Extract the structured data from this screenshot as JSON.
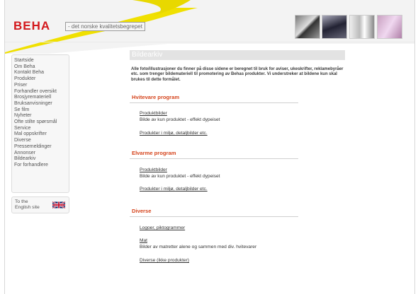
{
  "brand": {
    "logo": "BEHA",
    "tagline": "- det norske kvalitetsbegrepet"
  },
  "colors": {
    "brand_red": "#d3181c",
    "section_orange": "#d5441c",
    "swoosh_yellow": "#f0e000"
  },
  "sidebar": {
    "items": [
      "Startside",
      "Om Beha",
      "Kontakt Beha",
      "Produkter",
      "Priser",
      "Forhandler oversikt",
      "Brosjyremateriell",
      "Bruksanvisninger",
      "Se film",
      "Nyheter",
      "Ofte stilte spørsmål",
      "Service",
      "Mal oppskrifter",
      "Diverse",
      "Pressemeldinger",
      "Annonser",
      "Bildearkiv",
      "For forhandlere"
    ]
  },
  "english_link": {
    "line1": "To the",
    "line2": "English site",
    "flag_icon": "uk-flag-icon"
  },
  "main": {
    "title": "Bildearkiv",
    "intro": "Alle foto/illustrasjoner du finner på disse sidene er beregnet til bruk for aviser, ukeskrifter, reklamebyråer etc. som trenger bildemateriell til promotering av Behas produkter. Vi understreker at bildene kun skal brukes til dette formålet."
  },
  "sections": [
    {
      "heading": "Hvitevare program",
      "items": [
        {
          "link": "Produktbilder",
          "desc": "Bilde av kun produktet - effekt dypeiset"
        },
        {
          "link": "Produkter i miljø, detaljbilder etc.",
          "desc": ""
        }
      ]
    },
    {
      "heading": "Elvarme program",
      "items": [
        {
          "link": "Produktbilder",
          "desc": "Bilde av kun produktet - effekt dypeiset"
        },
        {
          "link": "Produkter i miljø, detaljbilder etc.",
          "desc": ""
        }
      ]
    },
    {
      "heading": "Diverse",
      "items": [
        {
          "link": "Logoer, piktogrammer",
          "desc": ""
        },
        {
          "link": "Mat",
          "desc": "Bilder av matretter alene og sammen med div. hvitevarer"
        },
        {
          "link": "Diverse (ikke produkter)",
          "desc": ""
        }
      ]
    }
  ]
}
